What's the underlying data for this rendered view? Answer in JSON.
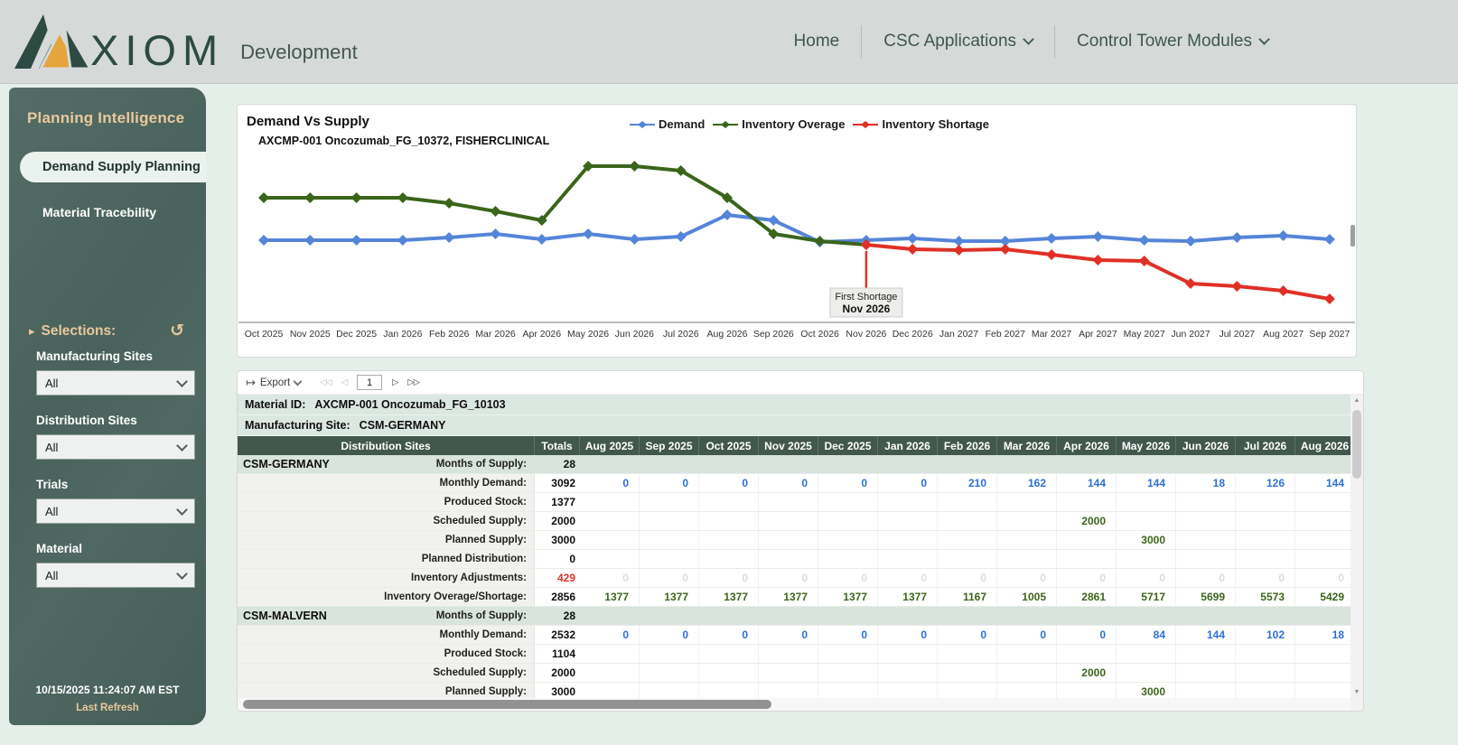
{
  "colors": {
    "brand_green": "#2d4a43",
    "brand_orange": "#e5a43c",
    "sidebar_bg": "#4d6560",
    "accent_tan": "#e9c89c",
    "table_header_bg": "#42574d",
    "group_row_bg": "#d8e4dc",
    "demand_blue": "#5585d9",
    "overage_green": "#3a651b",
    "shortage_red": "#e03026",
    "value_blue": "#2e6fd6",
    "value_green": "#3e641c",
    "value_red": "#de3526"
  },
  "icons": {
    "export": "↦",
    "reset": "↺",
    "selections_arrow": "▸",
    "pager_first": "◁◁",
    "pager_prev": "◁",
    "pager_next": "▷",
    "pager_last": "▷▷",
    "scroll_up": "▲",
    "scroll_down": "▼"
  },
  "header": {
    "logo_text": "XIOM",
    "env_label": "Development",
    "nav": [
      {
        "label": "Home",
        "dropdown": false
      },
      {
        "label": "CSC Applications",
        "dropdown": true
      },
      {
        "label": "Control Tower Modules",
        "dropdown": true
      }
    ]
  },
  "sidebar": {
    "title": "Planning Intelligence",
    "items": [
      {
        "label": "Demand Supply Planning",
        "active": true
      },
      {
        "label": "Material Tracebility",
        "active": false
      }
    ],
    "selections_label": "Selections:",
    "filters": [
      {
        "label": "Manufacturing Sites",
        "value": "All"
      },
      {
        "label": "Distribution Sites",
        "value": "All"
      },
      {
        "label": "Trials",
        "value": "All"
      },
      {
        "label": "Material",
        "value": "All"
      }
    ],
    "last_refresh_time": "10/15/2025 11:24:07 AM EST",
    "last_refresh_label": "Last Refresh"
  },
  "chart": {
    "title": "Demand Vs Supply",
    "subtitle": "AXCMP-001 Oncozumab_FG_10372, FISHERCLINICAL"
  },
  "chart_data": {
    "type": "line",
    "title": "Demand Vs Supply",
    "subtitle": "AXCMP-001 Oncozumab_FG_10372, FISHERCLINICAL",
    "legend_position": "top",
    "grid": false,
    "y_axis_visible": false,
    "y_unit": "relative level (no y-axis labels shown in chart)",
    "ylim": [
      0,
      200
    ],
    "x": [
      "Oct 2025",
      "Nov 2025",
      "Dec 2025",
      "Jan 2026",
      "Feb 2026",
      "Mar 2026",
      "Apr 2026",
      "May 2026",
      "Jun 2026",
      "Jul 2026",
      "Aug 2026",
      "Sep 2026",
      "Oct 2026",
      "Nov 2026",
      "Dec 2026",
      "Jan 2027",
      "Feb 2027",
      "Mar 2027",
      "Apr 2027",
      "May 2027",
      "Jun 2027",
      "Jul 2027",
      "Aug 2027",
      "Sep 2027"
    ],
    "series": [
      {
        "name": "Demand",
        "color": "#5585d9",
        "values": [
          90,
          90,
          90,
          90,
          93,
          97,
          91,
          97,
          91,
          94,
          118,
          112,
          88,
          90,
          92,
          89,
          89,
          92,
          94,
          90,
          89,
          93,
          95,
          91
        ]
      },
      {
        "name": "Inventory Overage",
        "color": "#3a651b",
        "values": [
          137,
          137,
          137,
          137,
          131,
          122,
          112,
          172,
          172,
          167,
          137,
          97,
          89,
          85,
          null,
          null,
          null,
          null,
          null,
          null,
          null,
          null,
          null,
          null
        ]
      },
      {
        "name": "Inventory Shortage",
        "color": "#e03026",
        "values": [
          null,
          null,
          null,
          null,
          null,
          null,
          null,
          null,
          null,
          null,
          null,
          null,
          null,
          85,
          80,
          79,
          80,
          74,
          68,
          67,
          42,
          39,
          34,
          25
        ]
      }
    ],
    "annotation": {
      "month": "Nov 2026",
      "series": "Inventory Shortage",
      "label": [
        "First Shortage",
        "Nov 2026"
      ]
    }
  },
  "table": {
    "toolbar": {
      "export_label": "Export",
      "page": "1"
    },
    "material_id_label": "Material ID:",
    "material_id_value": "AXCMP-001 Oncozumab_FG_10103",
    "manufacturing_site_label": "Manufacturing Site:",
    "manufacturing_site_value": "CSM-GERMANY",
    "columns": [
      "Distribution Sites",
      "Totals",
      "Aug 2025",
      "Sep 2025",
      "Oct 2025",
      "Nov 2025",
      "Dec 2025",
      "Jan 2026",
      "Feb 2026",
      "Mar 2026",
      "Apr 2026",
      "May 2026",
      "Jun 2026",
      "Jul 2026",
      "Aug 2026"
    ],
    "groups": [
      {
        "site": "CSM-GERMANY",
        "rows": [
          {
            "label": "Months of Supply:",
            "total": "28",
            "style": "group",
            "months": []
          },
          {
            "label": "Monthly Demand:",
            "total": "3092",
            "style": "blue",
            "months": [
              "0",
              "0",
              "0",
              "0",
              "0",
              "0",
              "210",
              "162",
              "144",
              "144",
              "18",
              "126",
              "144"
            ]
          },
          {
            "label": "Produced Stock:",
            "total": "1377",
            "months": []
          },
          {
            "label": "Scheduled Supply:",
            "total": "2000",
            "style": "green",
            "months": [
              "",
              "",
              "",
              "",
              "",
              "",
              "",
              "",
              "2000",
              "",
              "",
              "",
              ""
            ]
          },
          {
            "label": "Planned Supply:",
            "total": "3000",
            "style": "green",
            "months": [
              "",
              "",
              "",
              "",
              "",
              "",
              "",
              "",
              "",
              "3000",
              "",
              "",
              ""
            ]
          },
          {
            "label": "Planned Distribution:",
            "total": "0",
            "months": []
          },
          {
            "label": "Inventory Adjustments:",
            "total": "429",
            "total_style": "red",
            "style": "faint",
            "months": [
              "0",
              "0",
              "0",
              "0",
              "0",
              "0",
              "0",
              "0",
              "0",
              "0",
              "0",
              "0",
              "0"
            ]
          },
          {
            "label": "Inventory Overage/Shortage:",
            "total": "2856",
            "style": "green",
            "months": [
              "1377",
              "1377",
              "1377",
              "1377",
              "1377",
              "1377",
              "1167",
              "1005",
              "2861",
              "5717",
              "5699",
              "5573",
              "5429"
            ]
          }
        ]
      },
      {
        "site": "CSM-MALVERN",
        "rows": [
          {
            "label": "Months of Supply:",
            "total": "28",
            "style": "group",
            "months": []
          },
          {
            "label": "Monthly Demand:",
            "total": "2532",
            "style": "blue",
            "months": [
              "0",
              "0",
              "0",
              "0",
              "0",
              "0",
              "0",
              "0",
              "0",
              "84",
              "144",
              "102",
              "18"
            ]
          },
          {
            "label": "Produced Stock:",
            "total": "1104",
            "months": []
          },
          {
            "label": "Scheduled Supply:",
            "total": "2000",
            "style": "green",
            "months": [
              "",
              "",
              "",
              "",
              "",
              "",
              "",
              "",
              "2000",
              "",
              "",
              "",
              ""
            ]
          },
          {
            "label": "Planned Supply:",
            "total": "3000",
            "style": "green",
            "months": [
              "",
              "",
              "",
              "",
              "",
              "",
              "",
              "",
              "",
              "3000",
              "",
              "",
              ""
            ]
          }
        ]
      }
    ]
  }
}
